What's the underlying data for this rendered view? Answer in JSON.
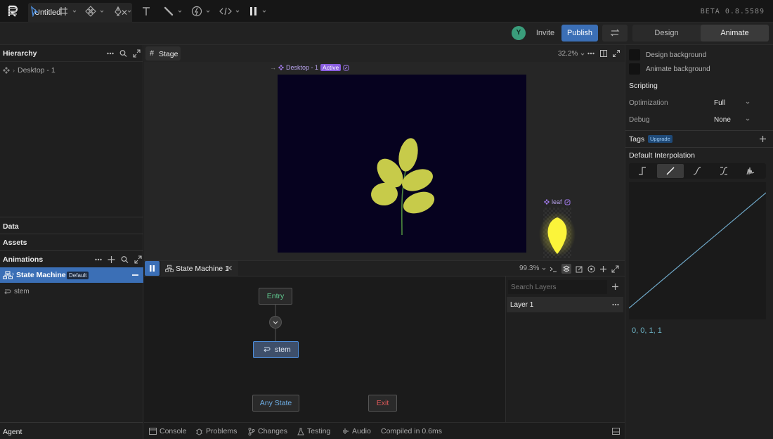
{
  "app": {
    "tab_title": "Untitled",
    "version": "BETA 0.8.5589"
  },
  "toolbar": {
    "avatar_initial": "Y",
    "invite_label": "Invite",
    "publish_label": "Publish",
    "mode_tabs": [
      "Design",
      "Animate"
    ],
    "active_mode": "Animate"
  },
  "hierarchy": {
    "title": "Hierarchy",
    "items": [
      "Desktop - 1"
    ]
  },
  "left_sections": {
    "data": "Data",
    "assets": "Assets",
    "agent": "Agent"
  },
  "animations": {
    "title": "Animations",
    "state_machine": {
      "name": "State Machine 1",
      "badge": "Default"
    },
    "items": [
      "stem"
    ]
  },
  "stage": {
    "tab": "Stage",
    "zoom": "32.2%",
    "artboard_label": "Desktop - 1",
    "artboard_badge": "Active",
    "element_label": "leaf"
  },
  "state_machine_panel": {
    "tab": "State Machine 1",
    "zoom": "99.3%",
    "nodes": {
      "entry": "Entry",
      "stem": "stem",
      "any": "Any State",
      "exit": "Exit"
    },
    "search_placeholder": "Search Layers",
    "layer": "Layer 1"
  },
  "status_bar": {
    "items": [
      "Console",
      "Problems",
      "Changes",
      "Testing",
      "Audio"
    ],
    "message": "Compiled in 0.6ms"
  },
  "inspector": {
    "design_background": "Design background",
    "animate_background": "Animate background",
    "scripting_title": "Scripting",
    "optimization_label": "Optimization",
    "optimization_value": "Full",
    "debug_label": "Debug",
    "debug_value": "None",
    "tags_title": "Tags",
    "tags_badge": "Upgrade",
    "interp_title": "Default Interpolation",
    "curve_values": "0, 0, 1, 1"
  },
  "colors": {
    "accent": "#3b6fb6",
    "artboard": "#06021f",
    "leaf": "#c7cb4a",
    "glow": "#fbf43a",
    "purple": "#a47cf0",
    "curve": "#6fa8c8"
  }
}
